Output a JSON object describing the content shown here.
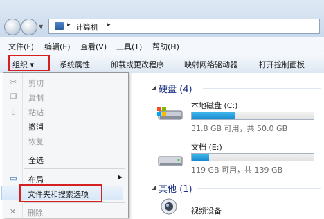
{
  "address": {
    "path": "计算机"
  },
  "menubar": [
    {
      "label": "文件(F)"
    },
    {
      "label": "编辑(E)"
    },
    {
      "label": "查看(V)"
    },
    {
      "label": "工具(T)"
    },
    {
      "label": "帮助(H)"
    }
  ],
  "toolbar": {
    "organize": "组织 ▾",
    "items": [
      "系统属性",
      "卸载或更改程序",
      "映射网络驱动器",
      "打开控制面板"
    ]
  },
  "context_menu": {
    "items": [
      {
        "label": "剪切",
        "enabled": false,
        "icon": "scissors-icon"
      },
      {
        "label": "复制",
        "enabled": false,
        "icon": "copy-icon"
      },
      {
        "label": "粘贴",
        "enabled": false,
        "icon": "paste-icon"
      },
      {
        "label": "撤消",
        "enabled": true
      },
      {
        "label": "恢复",
        "enabled": false
      },
      {
        "label": "全选",
        "enabled": true
      },
      {
        "label": "布局",
        "enabled": true,
        "submenu": true,
        "icon": "layout-icon"
      },
      {
        "label": "文件夹和搜索选项",
        "enabled": true,
        "highlighted": true
      },
      {
        "label": "删除",
        "enabled": false,
        "icon": "delete-icon"
      }
    ]
  },
  "pane": {
    "hard_disks": {
      "header": "硬盘 (4)",
      "drives": [
        {
          "name": "本地磁盘 (C:)",
          "info": "31.8 GB 可用，共 50.0 GB",
          "used_fraction": 0.36
        },
        {
          "name": "文档 (E:)",
          "info": "119 GB 可用，共 139 GB",
          "used_fraction": 0.14
        }
      ]
    },
    "other": {
      "header": "其他 (1)",
      "items": [
        {
          "name": "视频设备"
        }
      ]
    }
  },
  "colors": {
    "highlight_box": "#d42020",
    "accent": "#1e3287",
    "bar": "#2aa0e0"
  }
}
